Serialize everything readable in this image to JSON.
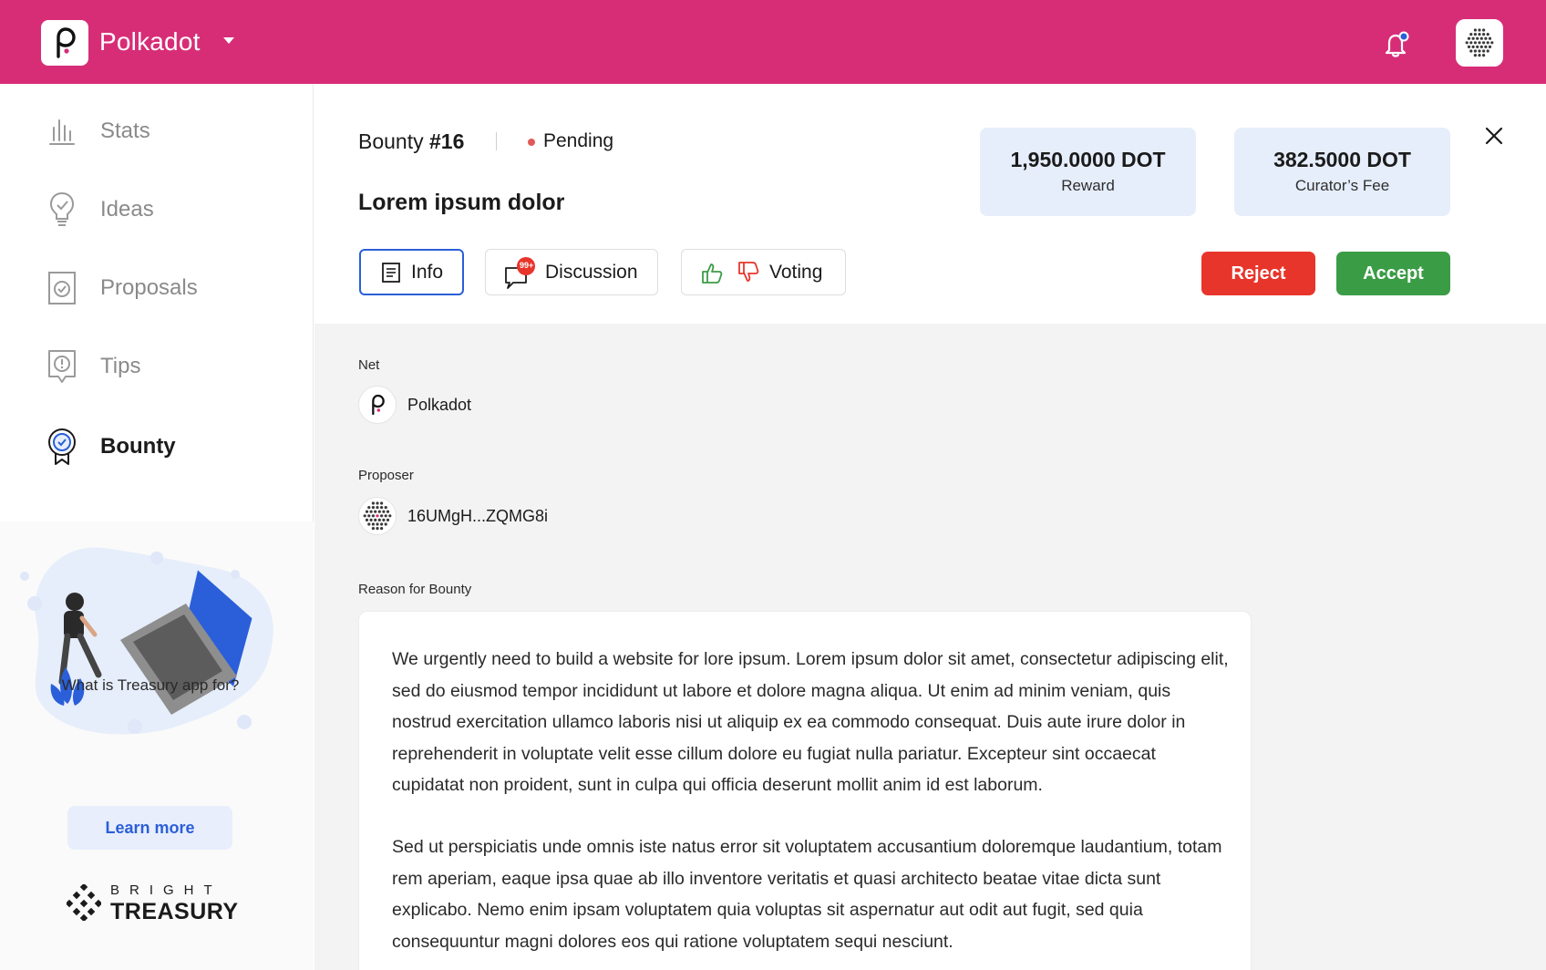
{
  "header": {
    "brand": "Polkadot",
    "icons": {
      "logo": "polkadot-logo-icon",
      "caret": "chevron-down-icon",
      "bell": "bell-icon",
      "avatar": "identicon-avatar"
    },
    "accent": "#d72d77"
  },
  "sidebar": {
    "items": [
      {
        "label": "Stats",
        "icon": "stats-icon",
        "active": false
      },
      {
        "label": "Ideas",
        "icon": "lightbulb-icon",
        "active": false
      },
      {
        "label": "Proposals",
        "icon": "proposal-icon",
        "active": false
      },
      {
        "label": "Tips",
        "icon": "tips-icon",
        "active": false
      },
      {
        "label": "Bounty",
        "icon": "bounty-badge-icon",
        "active": true
      }
    ],
    "promo": {
      "question": "What is Treasury app for?",
      "learn_more": "Learn more",
      "logo_small": "BRIGHT",
      "logo_big": "TREASURY"
    }
  },
  "bounty": {
    "id_prefix": "Bounty ",
    "id_number": "#16",
    "status": "Pending",
    "status_color": "#e05a5a",
    "title": "Lorem ipsum dolor",
    "reward": {
      "value": "1,950.0000 DOT",
      "label": "Reward"
    },
    "fee": {
      "value": "382.5000 DOT",
      "label": "Curator’s Fee"
    },
    "tabs": [
      {
        "label": "Info",
        "active": true
      },
      {
        "label": "Discussion",
        "badge": "99+"
      },
      {
        "label": "Voting"
      }
    ],
    "actions": {
      "reject": "Reject",
      "accept": "Accept"
    },
    "net": {
      "label": "Net",
      "value": "Polkadot"
    },
    "proposer": {
      "label": "Proposer",
      "value": "16UMgH...ZQMG8i"
    },
    "reason": {
      "label": "Reason for Bounty",
      "paragraphs": [
        "We urgently need to build a website for lore ipsum. Lorem ipsum dolor sit amet, consectetur adipiscing elit, sed do eiusmod tempor incididunt ut labore et dolore magna aliqua. Ut enim ad minim veniam, quis nostrud exercitation ullamco laboris nisi ut aliquip ex ea commodo consequat. Duis aute irure dolor in reprehenderit in voluptate velit esse cillum dolore eu fugiat nulla pariatur. Excepteur sint occaecat cupidatat non proident, sunt in culpa qui officia deserunt mollit anim id est laborum.",
        "Sed ut perspiciatis unde omnis iste natus error sit voluptatem accusantium doloremque laudantium, totam rem aperiam, eaque ipsa quae ab illo inventore veritatis et quasi architecto beatae vitae dicta sunt explicabo. Nemo enim ipsam voluptatem quia voluptas sit aspernatur aut odit aut fugit, sed quia consequuntur magni dolores eos qui ratione voluptatem sequi nesciunt."
      ]
    }
  }
}
